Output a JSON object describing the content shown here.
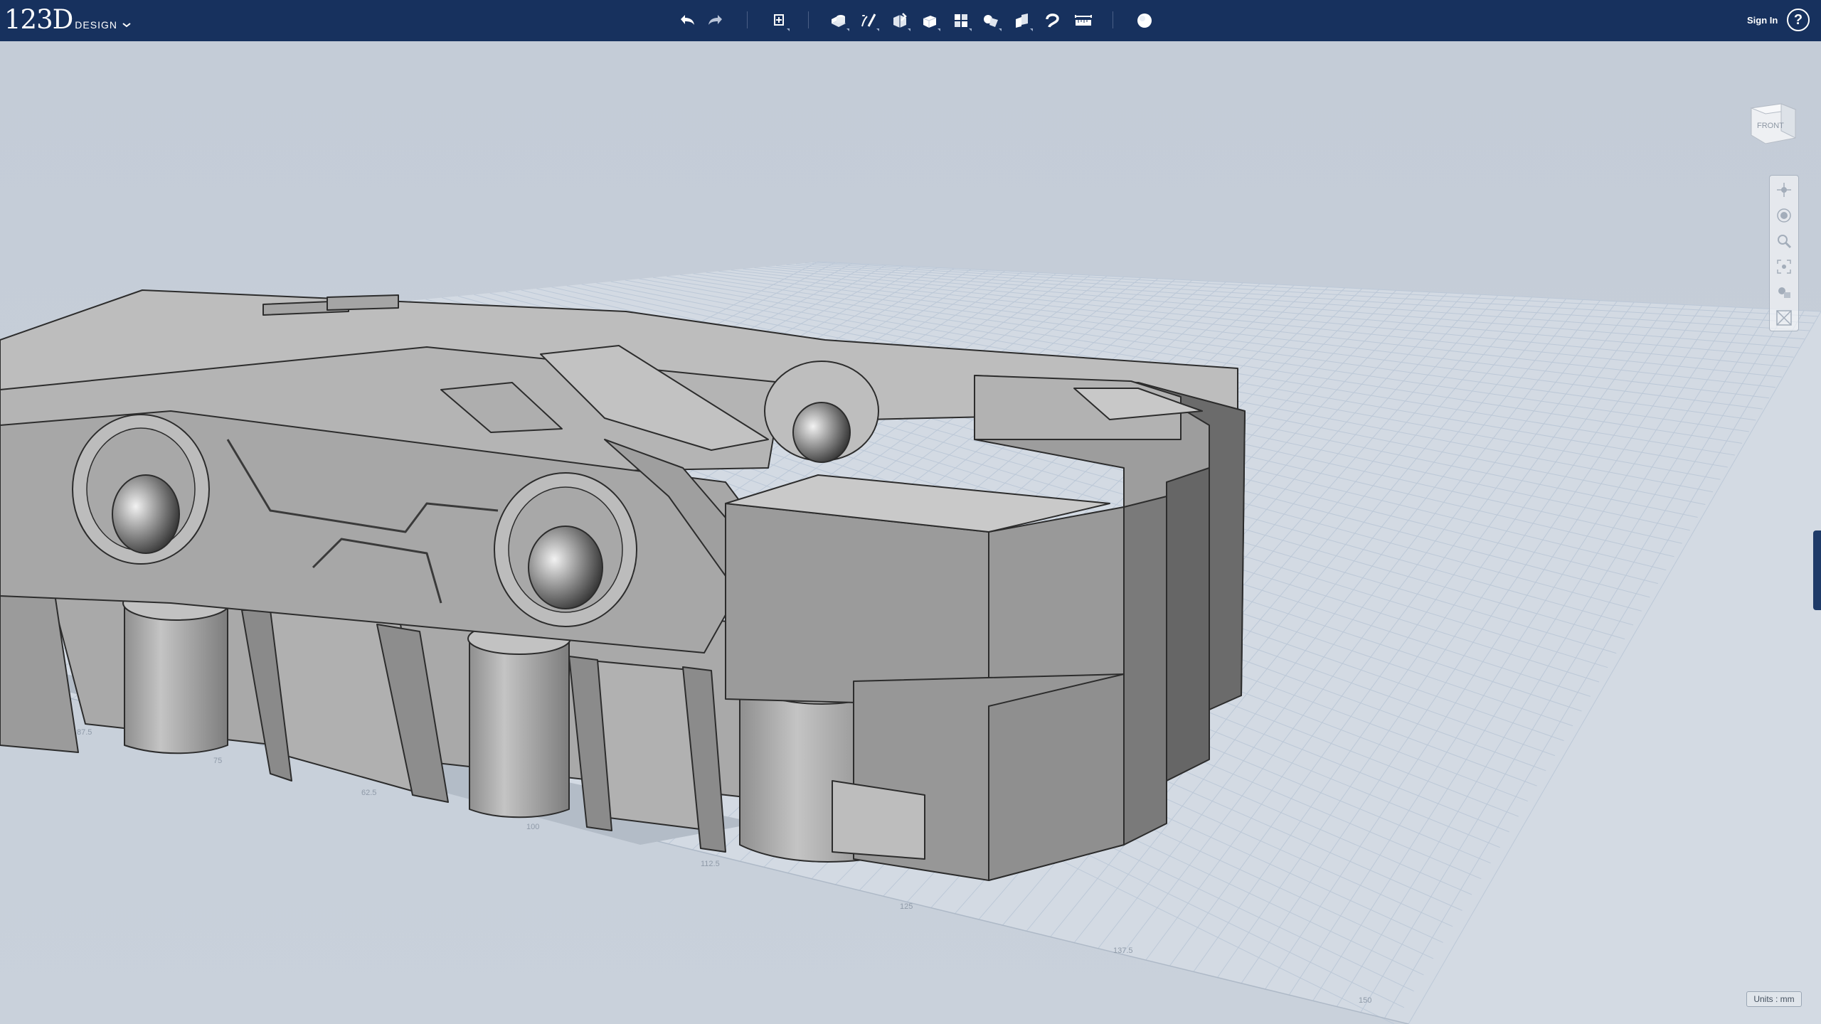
{
  "app": {
    "logo_number": "123D",
    "logo_word": "DESIGN",
    "logo_menu_icon": "chevron-down-icon"
  },
  "toolbar": {
    "undo": "undo-icon",
    "redo": "redo-icon",
    "transform": "transform-icon",
    "tools": [
      "primitives-icon",
      "sketch-icon",
      "construct-icon",
      "modify-icon",
      "pattern-icon",
      "grouping-icon",
      "combine-icon",
      "snap-icon",
      "measure-icon"
    ],
    "material": "material-icon"
  },
  "header": {
    "signin_label": "Sign In",
    "help_label": "?"
  },
  "viewcube": {
    "face_label": "FRONT"
  },
  "navbar": {
    "tools": [
      "pan-icon",
      "orbit-icon",
      "zoom-icon",
      "fit-all-icon",
      "visibility-icon",
      "ortho-perspective-icon"
    ]
  },
  "grid": {
    "tick_labels": [
      "87.5",
      "75",
      "62.5",
      "100",
      "112.5",
      "125",
      "137.5",
      "150"
    ]
  },
  "status": {
    "units_label": "Units : mm"
  },
  "colors": {
    "toolbar_bg": "#17315e",
    "viewport_bg": "#c6ced8",
    "model_gray": "#a6a6a6",
    "grid_line": "#b9c6d6"
  }
}
